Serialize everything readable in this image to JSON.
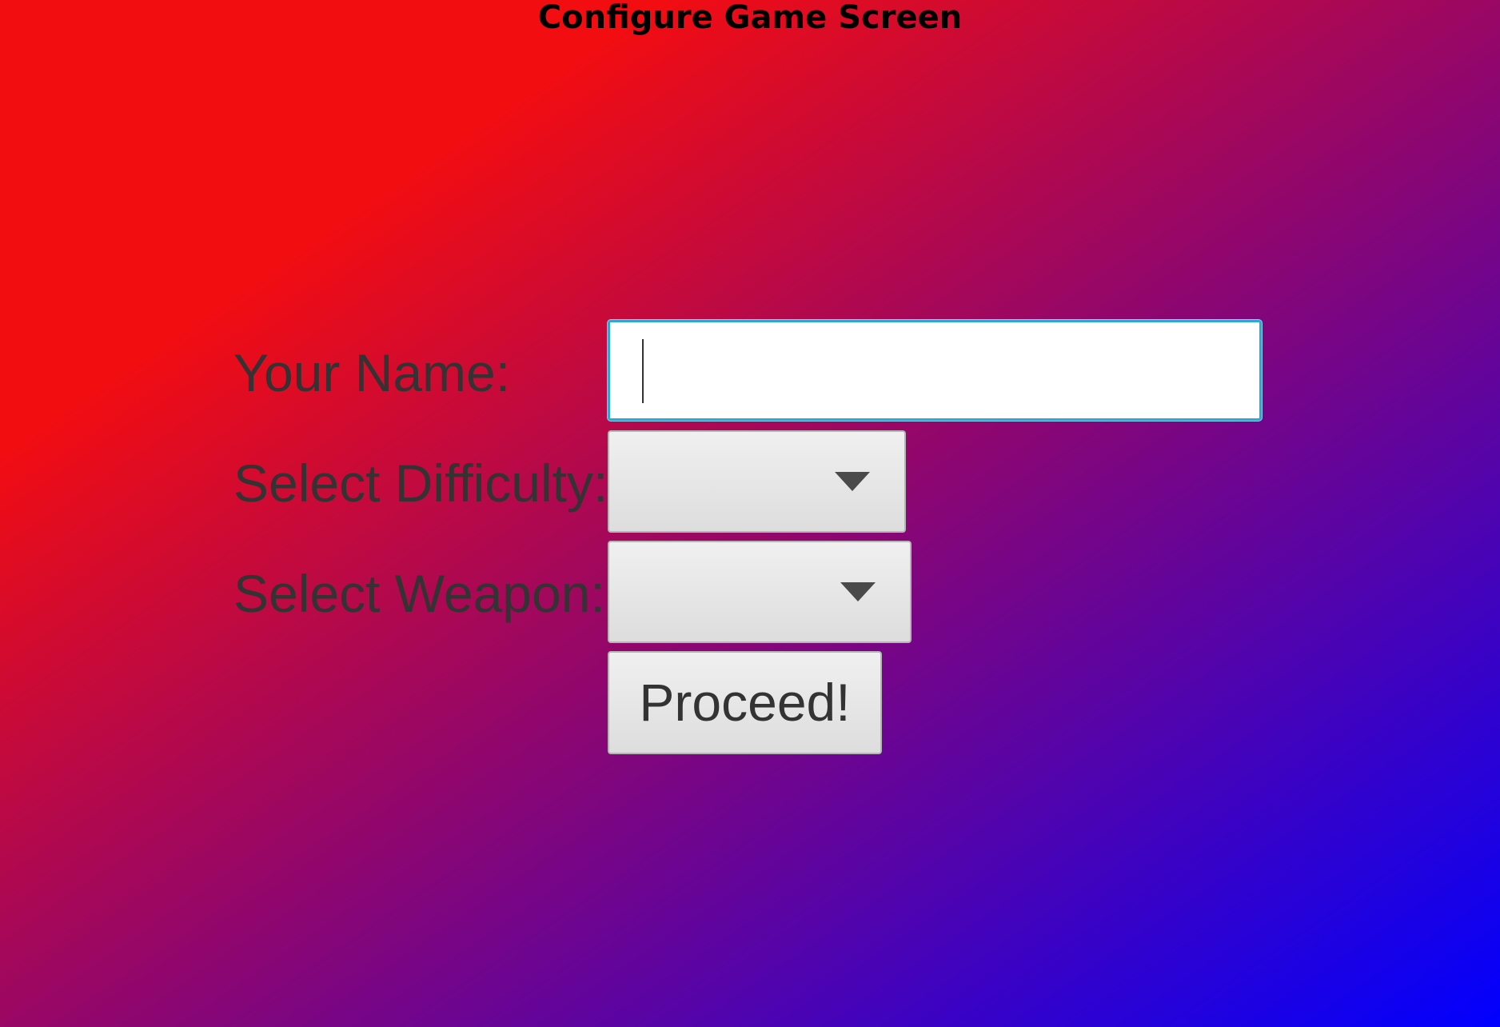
{
  "screen": {
    "title": "Configure Game Screen"
  },
  "form": {
    "name_label": "Your Name:",
    "name_value": "",
    "difficulty_label": "Select Difficulty:",
    "difficulty_value": "",
    "weapon_label": "Select Weapon:",
    "weapon_value": "",
    "proceed_label": "Proceed!"
  },
  "colors": {
    "gradient_start": "#f20d11",
    "gradient_mid": "#8a0673",
    "gradient_end": "#0000ff",
    "focus_border": "#2aa8d8",
    "label_text": "#333333"
  },
  "icons": {
    "dropdown": "chevron-down-icon"
  }
}
